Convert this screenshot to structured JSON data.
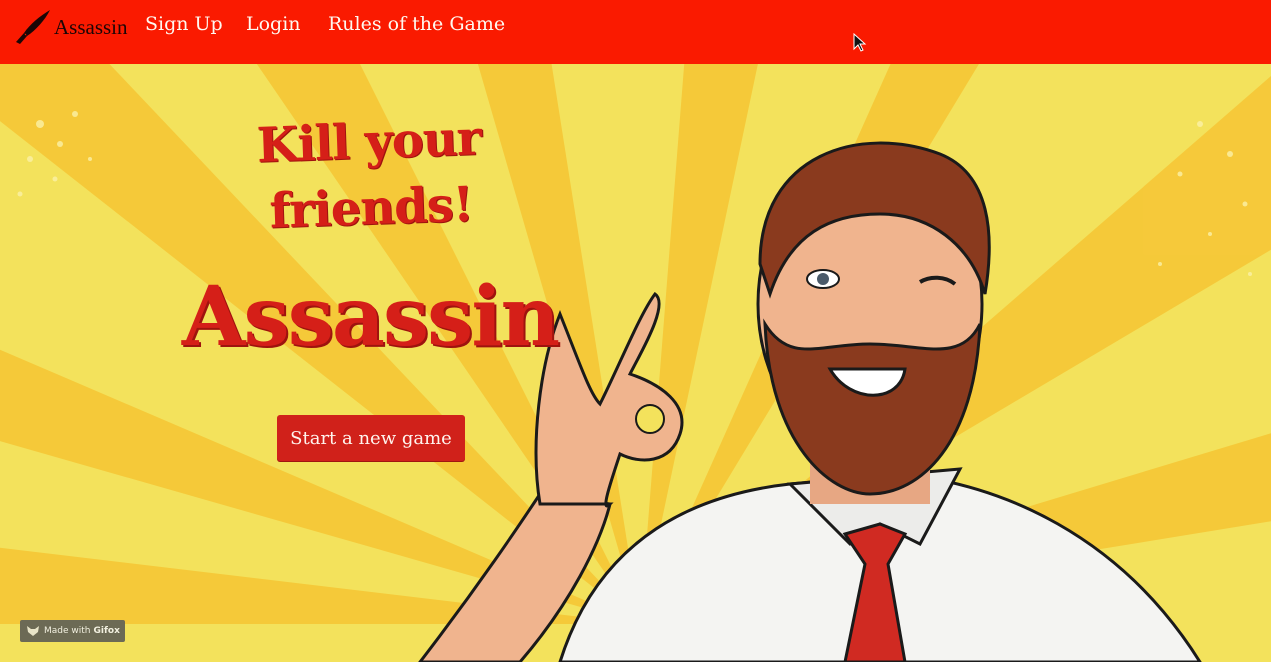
{
  "navbar": {
    "brand_text": "Assassin",
    "brand_icon": "knife-icon",
    "links": [
      "Sign Up",
      "Login",
      "Rules of the Game"
    ]
  },
  "hero": {
    "tagline_line1": "Kill your",
    "tagline_line2": "friends!",
    "title": "Assassin",
    "cta_label": "Start a new game",
    "illustration": "winking-bearded-man-ok-gesture"
  },
  "watermark": {
    "prefix": "Made with",
    "brand": "Gifox"
  },
  "colors": {
    "navbar_bg": "#fa1a00",
    "hero_bg": "#f3e25c",
    "accent_red": "#d51f18",
    "button_bg": "#d0211a"
  }
}
